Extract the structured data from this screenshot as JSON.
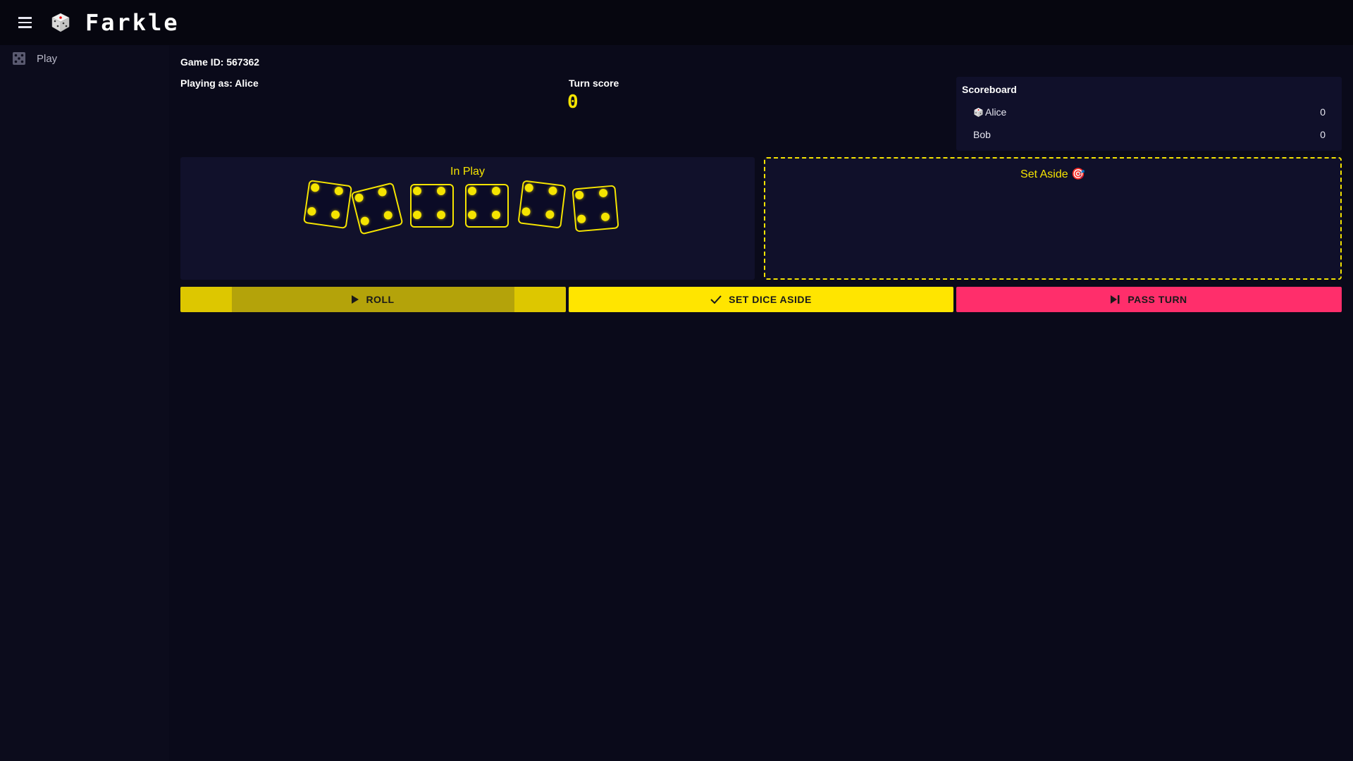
{
  "app": {
    "title": "Farkle",
    "menu_icon": "hamburger-menu-icon",
    "logo_icon": "dice-logo-icon"
  },
  "sidebar": {
    "items": [
      {
        "label": "Play",
        "icon": "dice-grid-icon"
      }
    ]
  },
  "game": {
    "id_label": "Game ID: 567362",
    "playing_as_label": "Playing as: Alice",
    "turn_score_label": "Turn score",
    "turn_score_value": "0"
  },
  "scoreboard": {
    "title": "Scoreboard",
    "players": [
      {
        "name": "Alice",
        "score": "0",
        "active": true,
        "icon": "dice-icon"
      },
      {
        "name": "Bob",
        "score": "0",
        "active": false
      }
    ]
  },
  "in_play": {
    "title": "In Play",
    "dice": [
      4,
      4,
      4,
      4,
      4,
      4
    ]
  },
  "set_aside": {
    "title": "Set Aside 🎯"
  },
  "actions": {
    "roll_label": "ROLL",
    "set_aside_label": "SET DICE ASIDE",
    "pass_label": "PASS TURN"
  },
  "colors": {
    "accent_yellow": "#f5e400",
    "pass_pink": "#ff2e6b",
    "background": "#0a0a1a"
  }
}
